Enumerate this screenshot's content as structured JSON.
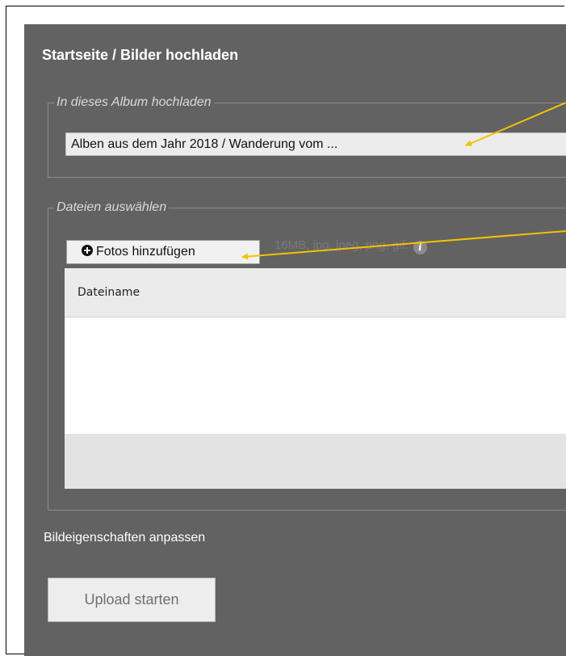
{
  "header": {
    "title": "Startseite / Bilder hochladen"
  },
  "album_group": {
    "legend": "In dieses Album hochladen",
    "selected_album": "Alben aus dem Jahr 2018 / Wanderung vom ..."
  },
  "files_group": {
    "legend": "Dateien auswählen",
    "add_button_label": "Fotos hinzufügen",
    "add_icon": "plus-circle-icon",
    "hint_text": "16MB, jpg, jpeg, png, gif.",
    "info_icon": "info-icon",
    "info_glyph": "i",
    "table": {
      "columns": [
        "Dateiname"
      ],
      "rows": []
    }
  },
  "properties": {
    "label": "Bildeigenschaften anpassen"
  },
  "actions": {
    "upload_label": "Upload starten"
  },
  "colors": {
    "panel_bg": "#626262",
    "arrow": "#f6c200",
    "input_bg": "#ececec",
    "table_header_bg": "#ebebeb",
    "table_footer_bg": "#e3e3e3"
  }
}
